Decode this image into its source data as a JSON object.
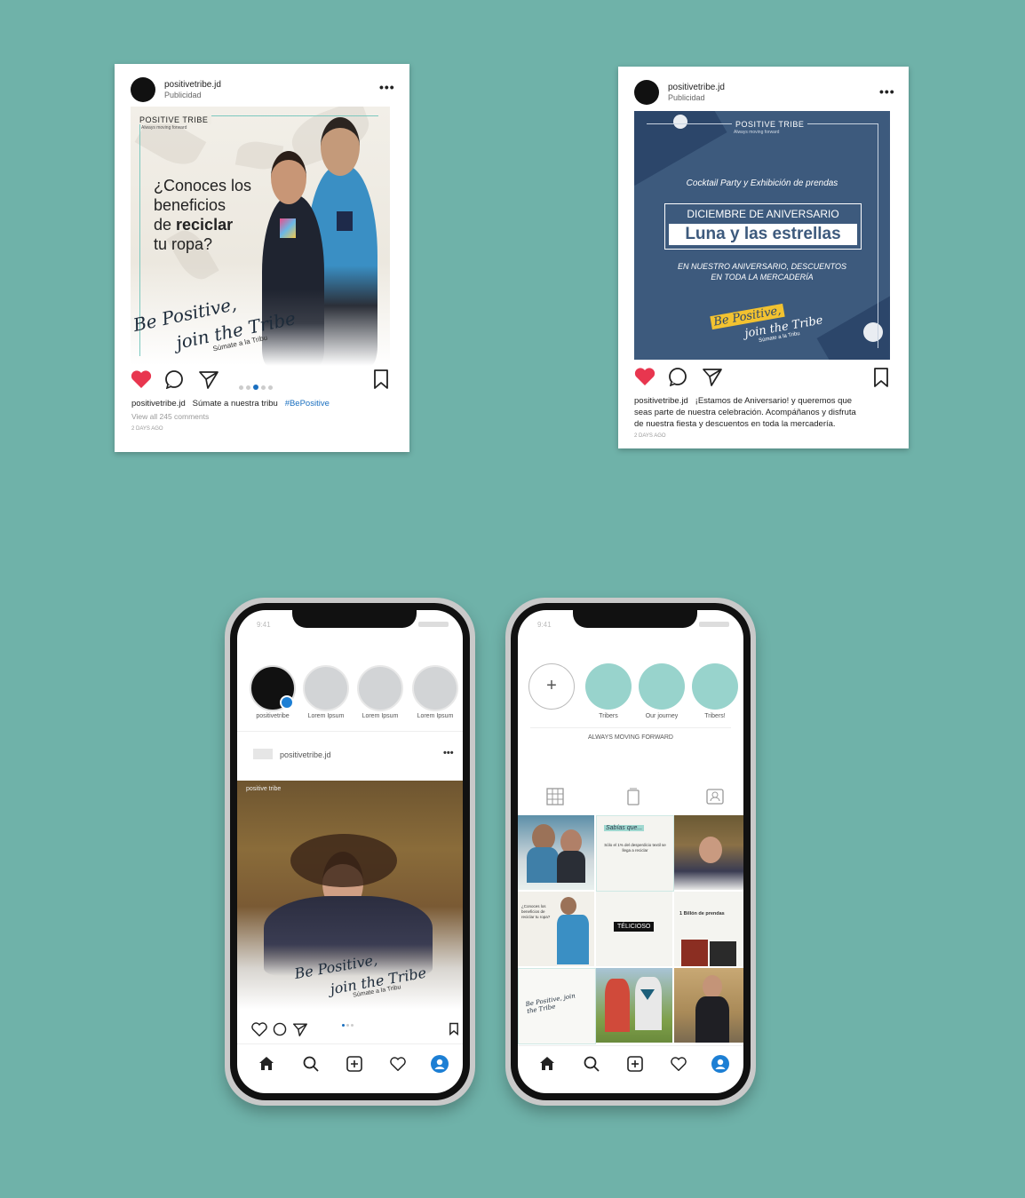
{
  "colors": {
    "background": "#6fb2a9",
    "heart": "#e8364f",
    "link": "#1a6fbf",
    "navy": "#3d5a7d",
    "teal_story": "#98d3cc",
    "profile_blue": "#1d7fd4"
  },
  "post1": {
    "username": "positivetribe.jd",
    "subtitle": "Publicidad",
    "menu": "•••",
    "brand": "POSITIVE TRIBE",
    "tagline": "Always moving forward",
    "question_1": "¿Conoces los",
    "question_2": "beneficios",
    "question_3a": "de ",
    "question_3b": "reciclar",
    "question_4": "tu ropa?",
    "script_1": "Be Positive,",
    "script_2": "join the Tribe",
    "script_3": "Súmate a la Tribu",
    "caption_user": "positivetribe.jd",
    "caption_text": "Súmate a nuestra tribu",
    "hashtag": "#BePositive",
    "comments": "View all 245 comments",
    "time": "2 DAYS AGO",
    "icons": [
      "heart-icon",
      "comment-icon",
      "send-icon",
      "bookmark-icon"
    ]
  },
  "post2": {
    "username": "positivetribe.jd",
    "subtitle": "Publicidad",
    "menu": "•••",
    "brand": "POSITIVE TRIBE",
    "tagline": "Always moving forward",
    "event": "Cocktail Party y Exhibición de prendas",
    "headline_1": "DICIEMBRE DE ANIVERSARIO",
    "headline_2": "Luna y  las estrellas",
    "promo_1": "EN NUESTRO ANIVERSARIO, DESCUENTOS",
    "promo_2": "EN TODA LA MERCADERÍA",
    "script_1": "Be Positive,",
    "script_2": "join the Tribe",
    "script_3": "Súmate a la Tribu",
    "caption_user": "positivetribe.jd",
    "caption_1": "¡Estamos de Aniversario! y queremos que",
    "caption_2": "seas parte de nuestra celebración. Acompáñanos y disfruta",
    "caption_3": "de nuestra fiesta y descuentos en toda la mercadería.",
    "time": "2 DAYS AGO"
  },
  "phone1": {
    "time": "9:41",
    "stories": [
      "positivetribe",
      "Lorem Ipsum",
      "Lorem Ipsum",
      "Lorem Ipsum"
    ],
    "post_user": "positivetribe.jd",
    "menu": "•••",
    "brand": "positive tribe",
    "script_1": "Be Positive,",
    "script_2": "join the Tribe",
    "script_3": "Súmate a la Tribu"
  },
  "phone2": {
    "time": "9:41",
    "add": "+",
    "highlights": [
      "Tribers",
      "Our journey",
      "Tribers!"
    ],
    "bio": "ALWAYS MOVING FORWARD",
    "grid_texts": [
      "Sabías que...",
      "Sólo el 1% del desperdicio textil se llega a reciclar",
      "¿Conoces los beneficios de reciclar tu ropa?",
      "TÉLICIOSO",
      "1 Billón de prendas",
      "Be Positive, join the Tribe"
    ]
  }
}
